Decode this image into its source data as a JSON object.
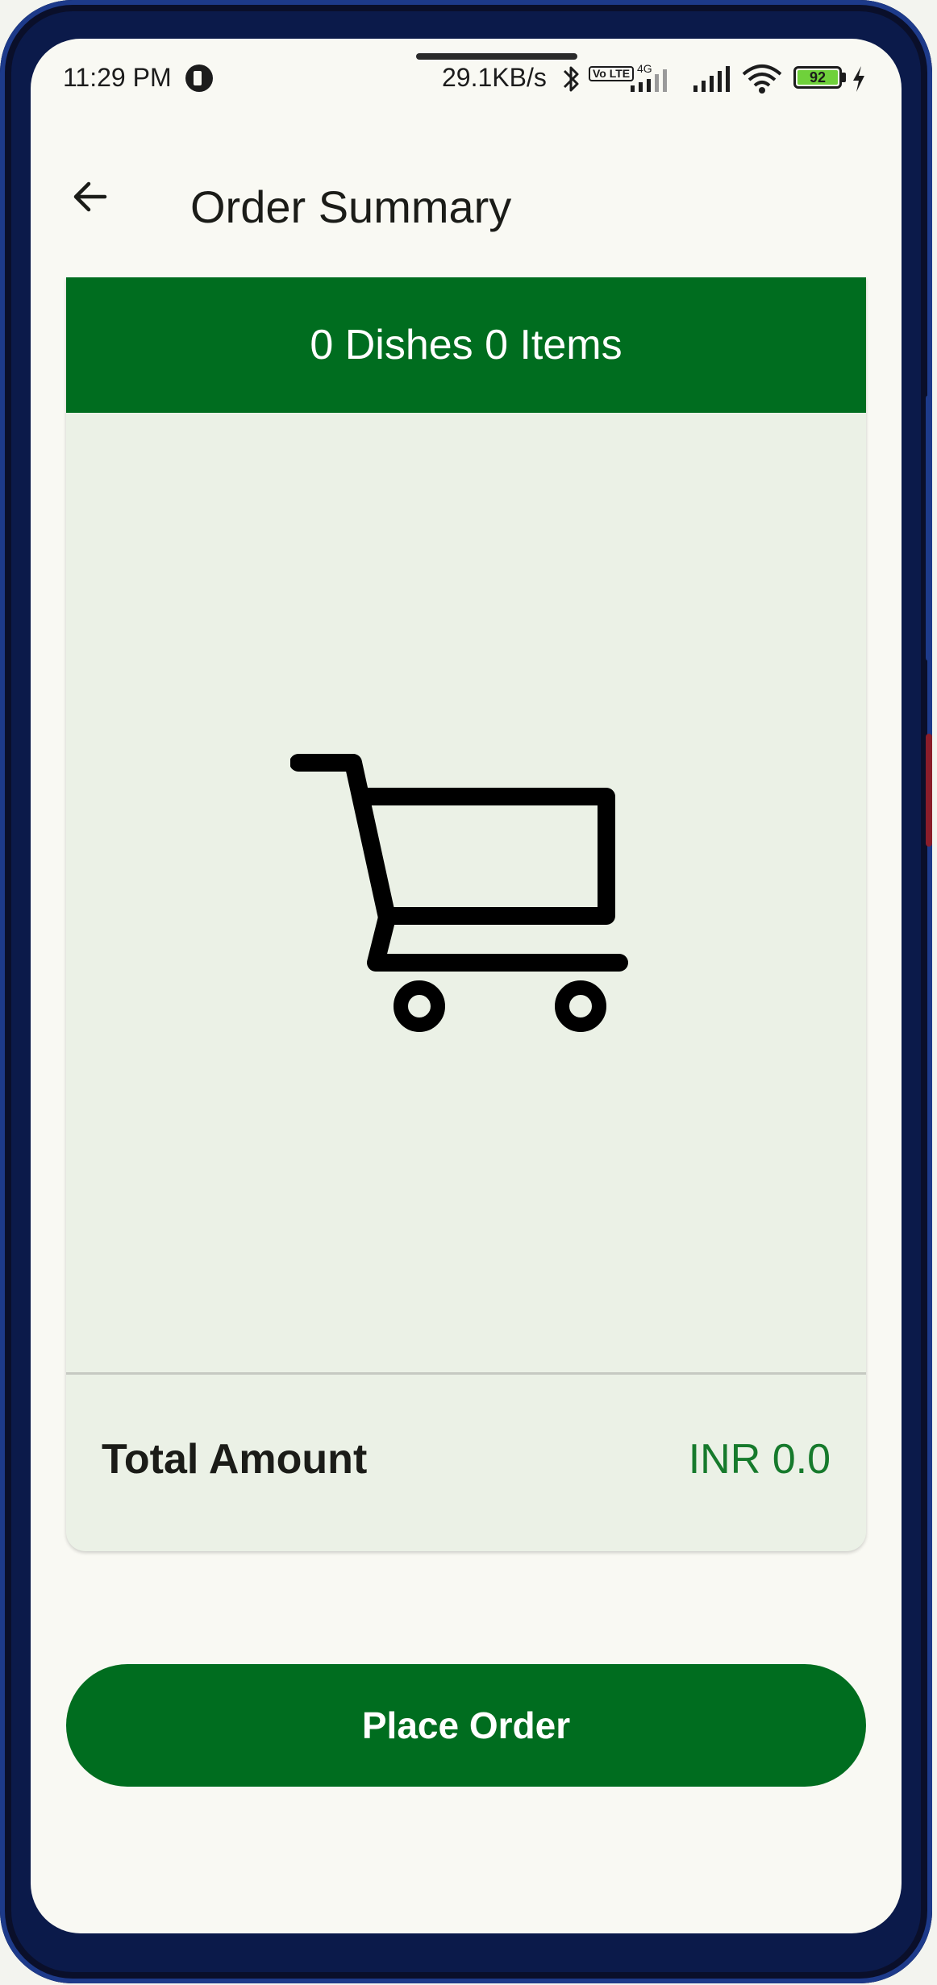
{
  "status_bar": {
    "time": "11:29 PM",
    "network_speed": "29.1KB/s",
    "network_type": "4G",
    "volte": "Vo LTE",
    "battery_level": "92",
    "icons": [
      "bluetooth-icon",
      "volte-icon",
      "signal-icon",
      "signal-icon",
      "wifi-icon",
      "battery-icon",
      "charging-icon"
    ]
  },
  "app_bar": {
    "title": "Order Summary",
    "back_icon": "arrow-left-icon"
  },
  "order_card": {
    "header": "0 Dishes 0 Items",
    "empty_icon": "shopping-cart-icon",
    "total_label": "Total Amount",
    "total_value": "INR 0.0"
  },
  "actions": {
    "place_order_label": "Place Order"
  },
  "colors": {
    "primary": "#006d1f",
    "surface": "#ebf1e6",
    "background": "#f9f9f3",
    "accent_text": "#167a2c"
  }
}
